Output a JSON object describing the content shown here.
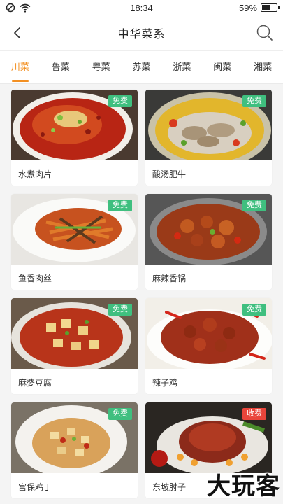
{
  "status": {
    "time": "18:34",
    "battery": "59%",
    "battery_level": 0.59
  },
  "header": {
    "title": "中华菜系",
    "back_icon": "chevron-left-icon",
    "search_icon": "search-icon"
  },
  "tabs": [
    {
      "label": "川菜",
      "active": true
    },
    {
      "label": "鲁菜",
      "active": false
    },
    {
      "label": "粤菜",
      "active": false
    },
    {
      "label": "苏菜",
      "active": false
    },
    {
      "label": "浙菜",
      "active": false
    },
    {
      "label": "闽菜",
      "active": false
    },
    {
      "label": "湘菜",
      "active": false
    }
  ],
  "accent_color": "#f39022",
  "dishes": [
    {
      "name": "水煮肉片",
      "badge": "免费",
      "badge_type": "free"
    },
    {
      "name": "酸汤肥牛",
      "badge": "免费",
      "badge_type": "free"
    },
    {
      "name": "鱼香肉丝",
      "badge": "免费",
      "badge_type": "free"
    },
    {
      "name": "麻辣香锅",
      "badge": "免费",
      "badge_type": "free"
    },
    {
      "name": "麻婆豆腐",
      "badge": "免费",
      "badge_type": "free"
    },
    {
      "name": "辣子鸡",
      "badge": "免费",
      "badge_type": "free"
    },
    {
      "name": "宫保鸡丁",
      "badge": "免费",
      "badge_type": "free"
    },
    {
      "name": "东坡肘子",
      "badge": "收费",
      "badge_type": "paid"
    }
  ],
  "badge_colors": {
    "free": "#3fbf7f",
    "paid": "#e9453b"
  },
  "watermark": "大玩客"
}
